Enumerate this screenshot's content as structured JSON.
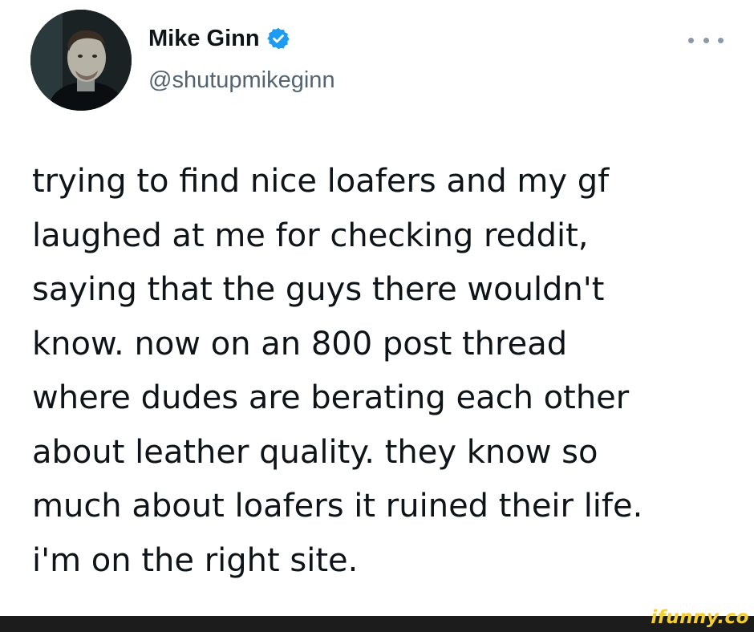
{
  "tweet": {
    "author": {
      "name": "Mike Ginn",
      "handle": "@shutupmikeginn",
      "verified": true,
      "verified_color": "#1d9bf0"
    },
    "more_icon": "more-horizontal-icon",
    "text": "trying to find nice loafers and my gf\nlaughed at me for checking reddit,\nsaying that the guys there wouldn't\nknow. now on an 800 post thread\nwhere dudes are berating each other\nabout leather quality. they know so\nmuch about loafers it ruined their life.\ni'm on the right site."
  },
  "watermark": {
    "text": "ifunny.co",
    "color": "#f6cf2a"
  },
  "colors": {
    "text_primary": "#0f1419",
    "text_secondary": "#536471",
    "footer": "#1c1c1c"
  }
}
